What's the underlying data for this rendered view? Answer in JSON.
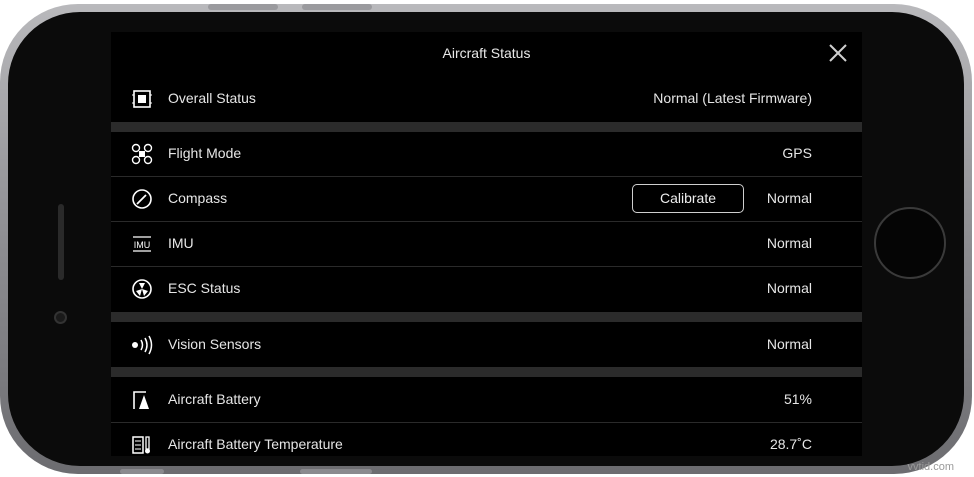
{
  "header": {
    "title": "Aircraft Status"
  },
  "rows": [
    {
      "label": "Overall Status",
      "value": "Normal (Latest Firmware)",
      "icon": "chip-icon"
    },
    {
      "label": "Flight Mode",
      "value": "GPS",
      "icon": "drone-icon"
    },
    {
      "label": "Compass",
      "value": "Normal",
      "icon": "compass-icon",
      "action": "Calibrate"
    },
    {
      "label": "IMU",
      "value": "Normal",
      "icon": "imu-icon"
    },
    {
      "label": "ESC Status",
      "value": "Normal",
      "icon": "propeller-icon"
    },
    {
      "label": "Vision Sensors",
      "value": "Normal",
      "icon": "sensor-icon"
    },
    {
      "label": "Aircraft Battery",
      "value": "51%",
      "icon": "battery-icon"
    },
    {
      "label": "Aircraft Battery Temperature",
      "value": "28.7˚C",
      "icon": "thermometer-icon"
    }
  ],
  "watermark": "vvtid.com"
}
